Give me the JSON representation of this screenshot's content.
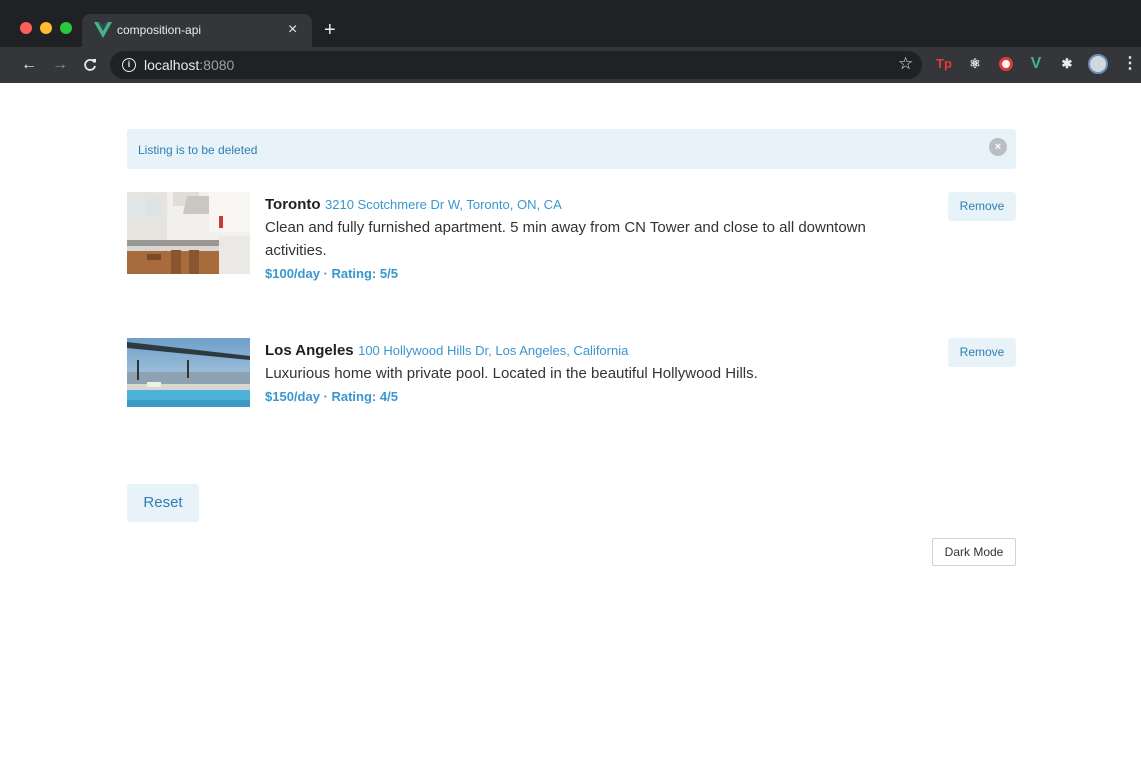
{
  "browser": {
    "tab_title": "composition-api",
    "tab_close": "×",
    "new_tab": "+",
    "url_host": "localhost",
    "url_port": ":8080",
    "back": "←",
    "forward": "→",
    "reload": "C",
    "star": "☆",
    "extensions": {
      "tp": "Tp",
      "react": "⚛",
      "vue": "V",
      "puzzle": "✱",
      "menu": "⋮"
    }
  },
  "alert": {
    "message": "Listing is to be deleted",
    "close": "×"
  },
  "listings": [
    {
      "city": "Toronto",
      "address": "3210 Scotchmere Dr W, Toronto, ON, CA",
      "description": "Clean and fully furnished apartment. 5 min away from CN Tower and close to all downtown activities.",
      "meta": "$100/day · Rating: 5/5",
      "remove_label": "Remove"
    },
    {
      "city": "Los Angeles",
      "address": "100 Hollywood Hills Dr, Los Angeles, California",
      "description": "Luxurious home with private pool. Located in the beautiful Hollywood Hills.",
      "meta": "$150/day · Rating: 4/5",
      "remove_label": "Remove"
    }
  ],
  "reset_label": "Reset",
  "dark_mode_label": "Dark Mode",
  "colors": {
    "accent": "#3b96d0",
    "button_bg": "#e8f3f9",
    "browser_chrome": "#202124"
  }
}
